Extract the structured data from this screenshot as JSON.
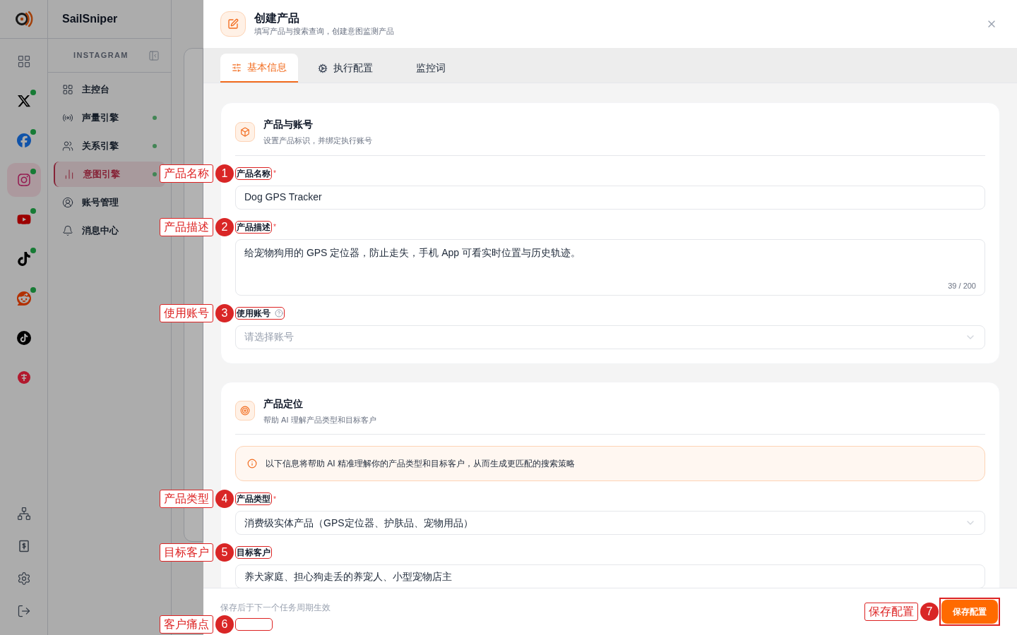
{
  "app": {
    "brand": "SailSniper",
    "rail": [
      {
        "kind": "grid",
        "selected": false,
        "online": false
      },
      {
        "kind": "x",
        "selected": false,
        "online": true
      },
      {
        "kind": "facebook",
        "selected": false,
        "online": true
      },
      {
        "kind": "instagram",
        "selected": true,
        "online": true
      },
      {
        "kind": "youtube",
        "selected": false,
        "online": true
      },
      {
        "kind": "tiktok",
        "selected": false,
        "online": true
      },
      {
        "kind": "reddit",
        "selected": false,
        "online": true
      },
      {
        "kind": "tiktok-round",
        "selected": false,
        "online": false
      },
      {
        "kind": "rednote",
        "selected": false,
        "online": false
      }
    ],
    "rail_bottom": [
      {
        "kind": "network"
      },
      {
        "kind": "bill"
      },
      {
        "kind": "settings"
      },
      {
        "kind": "logout"
      }
    ],
    "sidebar": {
      "title": "INSTAGRAM",
      "items": [
        {
          "label": "主控台",
          "selected": false,
          "status": false
        },
        {
          "label": "声量引擎",
          "selected": false,
          "status": true
        },
        {
          "label": "关系引擎",
          "selected": false,
          "status": true
        },
        {
          "label": "意图引擎",
          "selected": true,
          "status": true
        },
        {
          "label": "账号管理",
          "selected": false,
          "status": false
        },
        {
          "label": "消息中心",
          "selected": false,
          "status": false
        }
      ]
    }
  },
  "drawer": {
    "title": "创建产品",
    "subtitle": "填写产品与搜索查询，创建意图监测产品",
    "tabs": [
      {
        "label": "基本信息",
        "selected": true
      },
      {
        "label": "执行配置",
        "selected": false
      },
      {
        "label": "监控词",
        "selected": false
      }
    ],
    "sections": [
      {
        "title": "产品与账号",
        "subtitle": "设置产品标识，并绑定执行账号",
        "fields": [
          {
            "kind": "input",
            "label": "产品名称",
            "required_mark": "*",
            "value": "Dog GPS Tracker",
            "annotation": {
              "number": "1",
              "label": "产品名称"
            }
          },
          {
            "kind": "textarea",
            "label": "产品描述",
            "required_mark": "*",
            "value": "给宠物狗用的 GPS 定位器，防止走失，手机 App 可看实时位置与历史轨迹。",
            "counter": "39 / 200",
            "annotation": {
              "number": "2",
              "label": "产品描述"
            }
          },
          {
            "kind": "select",
            "label": "使用账号",
            "help": true,
            "placeholder": "请选择账号",
            "annotation": {
              "number": "3",
              "label": "使用账号"
            }
          }
        ]
      },
      {
        "title": "产品定位",
        "subtitle": "帮助 AI 理解产品类型和目标客户",
        "notice": "以下信息将帮助 AI 精准理解你的产品类型和目标客户，从而生成更匹配的搜索策略",
        "fields": [
          {
            "kind": "select",
            "label": "产品类型",
            "required_mark": "*",
            "value": "消费级实体产品（GPS定位器、护肤品、宠物用品）",
            "annotation": {
              "number": "4",
              "label": "产品类型"
            }
          },
          {
            "kind": "input",
            "label": "目标客户",
            "value": "养犬家庭、担心狗走丢的养宠人、小型宠物店主",
            "annotation": {
              "number": "5",
              "label": "目标客户"
            }
          }
        ]
      }
    ],
    "footer": {
      "note": "保存后于下一个任务周期生效",
      "annotation": {
        "number": "6",
        "label": "客户痛点"
      },
      "save_button": {
        "label": "保存配置",
        "annotation": {
          "number": "7",
          "label": "保存配置"
        }
      }
    }
  }
}
